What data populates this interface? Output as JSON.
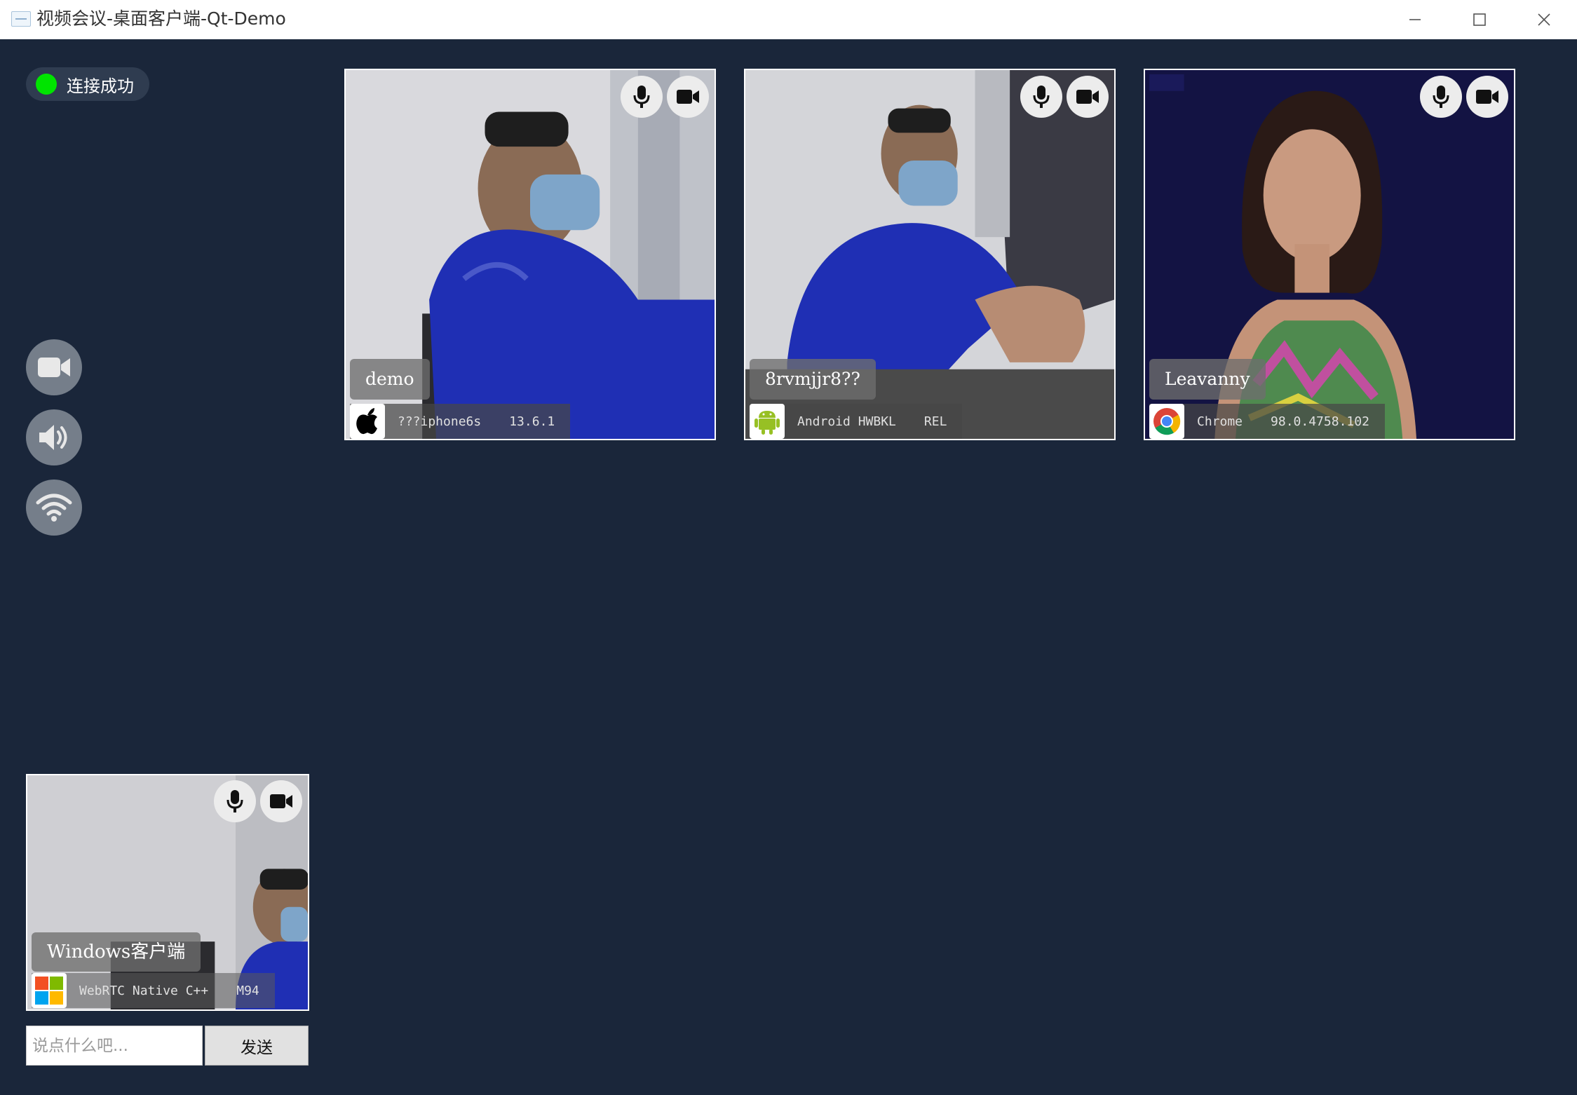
{
  "window": {
    "title": "视频会议-桌面客户端-Qt-Demo",
    "icons": [
      "app-icon",
      "minimize-icon",
      "maximize-icon",
      "close-icon"
    ]
  },
  "status": {
    "label": "连接成功",
    "indicator_color": "#00e400"
  },
  "controls": [
    {
      "name": "camera-toggle",
      "icon": "video-camera-icon"
    },
    {
      "name": "speaker-toggle",
      "icon": "speaker-icon"
    },
    {
      "name": "network",
      "icon": "wifi-icon"
    }
  ],
  "participants": [
    {
      "name": "demo",
      "os_icon": "apple-icon",
      "device": "???iphone6s",
      "version": "13.6.1"
    },
    {
      "name": "8rvmjjr8??",
      "os_icon": "android-icon",
      "device": "Android HWBKL",
      "version": "REL"
    },
    {
      "name": "Leavanny",
      "os_icon": "chrome-icon",
      "device": "Chrome",
      "version": "98.0.4758.102"
    }
  ],
  "local": {
    "name": "Windows客户端",
    "os_icon": "windows-icon",
    "device": "WebRTC Native C++",
    "version": "M94"
  },
  "chat": {
    "placeholder": "说点什么吧...",
    "send_label": "发送"
  },
  "colors": {
    "background": "#1a263a",
    "status_pill": "#2f3c50",
    "control_button": "#757e8a"
  }
}
